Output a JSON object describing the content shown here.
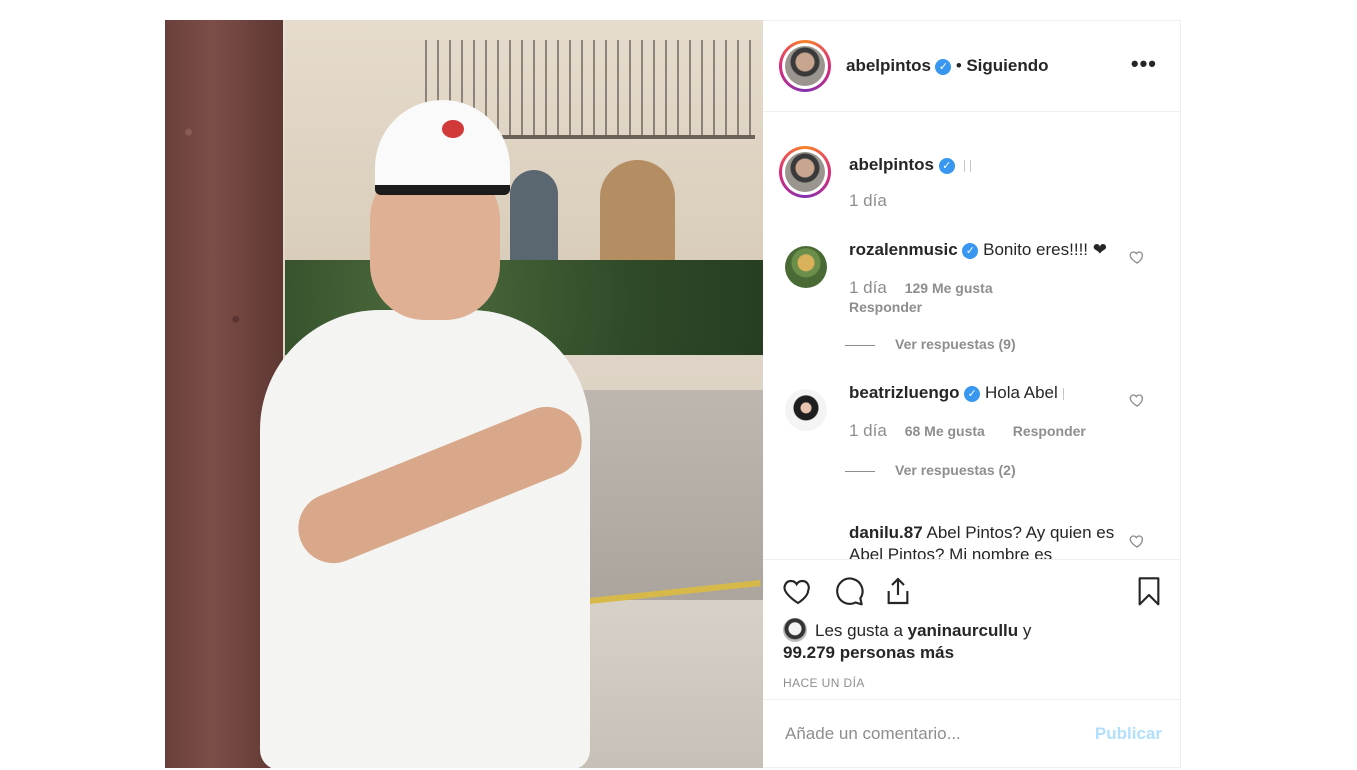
{
  "post_author": {
    "username": "abelpintos",
    "verified_symbol": "✓",
    "separator": "•",
    "follow_status": "Siguiendo",
    "more_symbol": "•••"
  },
  "caption": {
    "username": "abelpintos",
    "time": "1 día"
  },
  "comments": [
    {
      "username": "rozalenmusic",
      "text": "Bonito eres!!!! ❤",
      "time": "1 día",
      "likes": "129 Me gusta",
      "reply": "Responder",
      "view_replies": "Ver respuestas (9)"
    },
    {
      "username": "beatrizluengo",
      "text": "Hola Abel",
      "time": "1 día",
      "likes": "68 Me gusta",
      "reply": "Responder",
      "view_replies": "Ver respuestas (2)"
    },
    {
      "username": "danilu.87",
      "text": "Abel Pintos? Ay quien es Abel Pintos? Mi nombre es"
    }
  ],
  "likes": {
    "prefix": "Les gusta a",
    "liker": "yaninaurcullu",
    "connector": "y",
    "others": "99.279 personas más"
  },
  "timestamp": "HACE UN DÍA",
  "composer": {
    "placeholder": "Añade un comentario...",
    "publish": "Publicar"
  },
  "icons": {
    "like": "heart-icon",
    "comment": "comment-icon",
    "share": "share-icon",
    "save": "bookmark-icon",
    "more": "more-options-icon"
  },
  "colors": {
    "verified": "#3897f0",
    "secondary_text": "#8e8e8e",
    "publish_disabled": "#b2dffc",
    "story_ring": "#dd2a7b"
  }
}
